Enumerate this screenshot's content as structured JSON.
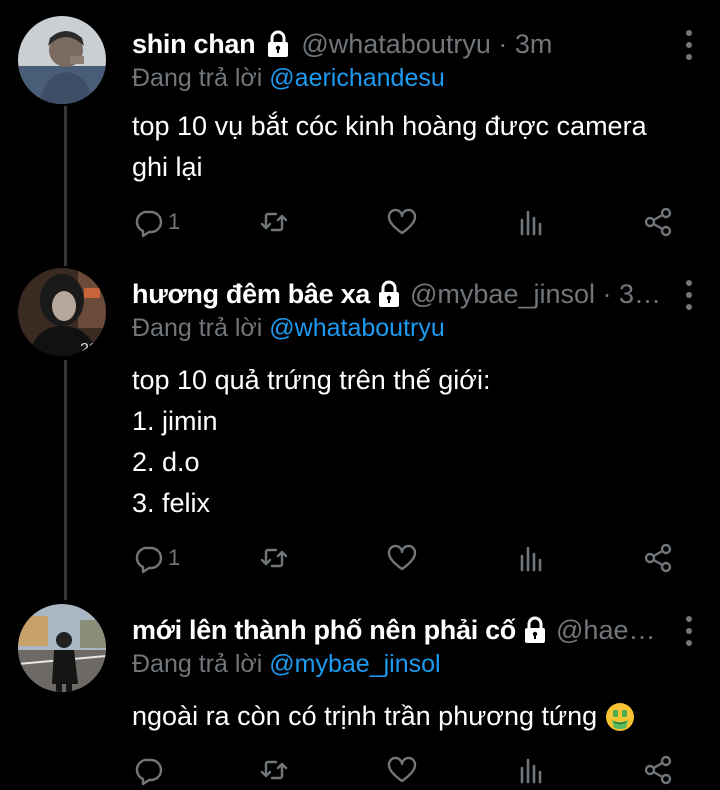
{
  "tweets": [
    {
      "name": "shin chan",
      "handle": "@whataboutryu · 3m",
      "reply_prefix": "Đang trả lời ",
      "reply_to": "@aerichandesu",
      "lines": [
        "top 10 vụ bắt cóc kinh hoàng được camera",
        "ghi lại"
      ],
      "reply_count": "1"
    },
    {
      "name": "hương đêm bâe xa",
      "handle": "@mybae_jinsol · 3…",
      "reply_prefix": "Đang trả lời ",
      "reply_to": "@whataboutryu",
      "lines": [
        "top 10 quả trứng trên thế giới:",
        "1. jimin",
        "2. d.o",
        "3. felix"
      ],
      "reply_count": "1"
    },
    {
      "name": "mới lên thành phố nên phải cố",
      "handle": "@hae…",
      "reply_prefix": "Đang trả lời ",
      "reply_to": "@mybae_jinsol",
      "lines": [
        "ngoài ra còn có trịnh trần phương tứng"
      ],
      "emoji": "money-mouth-face",
      "reply_count": ""
    }
  ],
  "icons": [
    "lock-icon",
    "reply-icon",
    "retweet-icon",
    "like-icon",
    "views-icon",
    "share-icon",
    "more-icon"
  ],
  "colors": {
    "background": "#000000",
    "muted": "#71767b",
    "link": "#1d9bf0",
    "thread_line": "#333639"
  }
}
